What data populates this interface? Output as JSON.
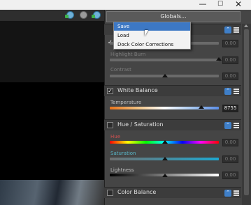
{
  "window": {
    "minimize_glyph": "—",
    "maximize_glyph": "☐",
    "close_glyph": "✕"
  },
  "globals_label": "Globals...",
  "menu": {
    "items": [
      "Save",
      "Load",
      "Dock Color Corrections"
    ],
    "highlighted_index": 0,
    "checked_index": 2
  },
  "sections": {
    "top": {
      "sliders": [
        {
          "label": "Highlight Burn",
          "value": "0.00"
        },
        {
          "label": "Contrast",
          "value": "0.00"
        }
      ],
      "hidden_value": "0.00"
    },
    "white_balance": {
      "title": "White Balance",
      "checked": true,
      "temperature": {
        "label": "Temperature",
        "value": "8755",
        "level": 0.84
      }
    },
    "hue_saturation": {
      "title": "Hue / Saturation",
      "checked": false,
      "sliders": [
        {
          "label": "Hue",
          "value": "0.00"
        },
        {
          "label": "Saturation",
          "value": "0.00"
        },
        {
          "label": "Lightness",
          "value": "0.00"
        }
      ]
    },
    "color_balance": {
      "title": "Color Balance",
      "checked": false
    }
  },
  "colors": {
    "accent": "#3d78c4",
    "panel": "#454545",
    "temperature_gradient": [
      "#e8731a",
      "#f0c080",
      "#ffffff",
      "#a8c8f0",
      "#5b8ee6"
    ]
  }
}
